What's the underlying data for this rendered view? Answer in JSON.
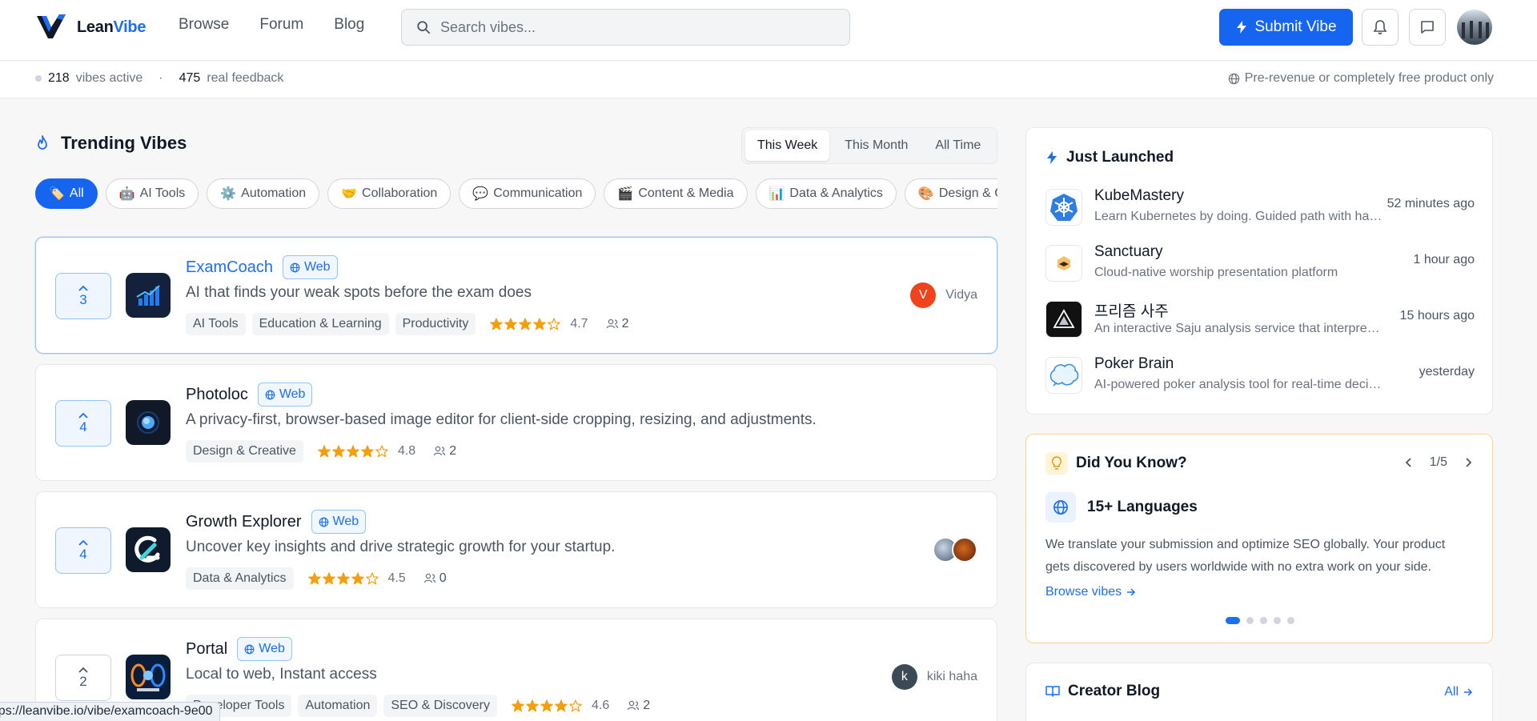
{
  "header": {
    "logo_text_a": "Lean",
    "logo_text_b": "Vibe",
    "nav": [
      "Browse",
      "Forum",
      "Blog"
    ],
    "search_placeholder": "Search vibes...",
    "submit_label": "Submit Vibe",
    "accent": "#1565f0"
  },
  "subbar": {
    "active_count": "218",
    "active_label": "vibes active",
    "separator": "·",
    "feedback_count": "475",
    "feedback_label": "real feedback",
    "notice": "Pre-revenue or completely free product only"
  },
  "trending": {
    "title": "Trending Vibes",
    "periods": [
      "This Week",
      "This Month",
      "All Time"
    ],
    "active_period": "This Week",
    "categories": [
      {
        "icon": "🏷️",
        "label": "All"
      },
      {
        "icon": "🤖",
        "label": "AI Tools"
      },
      {
        "icon": "⚙️",
        "label": "Automation"
      },
      {
        "icon": "🤝",
        "label": "Collaboration"
      },
      {
        "icon": "💬",
        "label": "Communication"
      },
      {
        "icon": "🎬",
        "label": "Content & Media"
      },
      {
        "icon": "📊",
        "label": "Data & Analytics"
      },
      {
        "icon": "🎨",
        "label": "Design & Creative"
      }
    ],
    "items": [
      {
        "votes": "3",
        "name": "ExamCoach",
        "platform": "Web",
        "desc": "AI that finds your weak spots before the exam does",
        "tags": [
          "AI Tools",
          "Education & Learning",
          "Productivity"
        ],
        "rating": "4.7",
        "stars": 4.7,
        "users": "2",
        "author": "Vidya",
        "author_initial": "V"
      },
      {
        "votes": "4",
        "name": "Photoloc",
        "platform": "Web",
        "desc": "A privacy-first, browser-based image editor for client-side cropping, resizing, and adjustments.",
        "tags": [
          "Design & Creative"
        ],
        "rating": "4.8",
        "stars": 4.8,
        "users": "2"
      },
      {
        "votes": "4",
        "name": "Growth Explorer",
        "platform": "Web",
        "desc": "Uncover key insights and drive strategic growth for your startup.",
        "tags": [
          "Data & Analytics"
        ],
        "rating": "4.5",
        "stars": 4.5,
        "users": "0"
      },
      {
        "votes": "2",
        "name": "Portal",
        "platform": "Web",
        "desc": "Local to web, Instant access",
        "tags": [
          "Developer Tools",
          "Automation",
          "SEO & Discovery"
        ],
        "rating": "4.6",
        "stars": 4.6,
        "users": "2",
        "author": "kiki haha",
        "author_initial": "k"
      }
    ]
  },
  "just_launched": {
    "title": "Just Launched",
    "items": [
      {
        "name": "KubeMastery",
        "desc": "Learn Kubernetes by doing. Guided path with hands-on labs",
        "time": "52 minutes ago"
      },
      {
        "name": "Sanctuary",
        "desc": "Cloud-native worship presentation platform",
        "time": "1 hour ago"
      },
      {
        "name": "프리즘 사주",
        "desc": "An interactive Saju analysis service that interprets your destiny",
        "time": "15 hours ago"
      },
      {
        "name": "Poker Brain",
        "desc": "AI-powered poker analysis tool for real-time decisions",
        "time": "yesterday"
      }
    ]
  },
  "did_you_know": {
    "title": "Did You Know?",
    "page": "1/5",
    "fact_title": "15+ Languages",
    "fact_body_1": "We translate your submission and optimize SEO globally. Your product",
    "fact_body_2": "gets discovered by users worldwide with no extra work on your side.",
    "link": "Browse vibes",
    "slides": 5,
    "active_slide": 1
  },
  "creator_blog": {
    "title": "Creator Blog",
    "link": "All"
  },
  "status_url": "https://leanvibe.io/vibe/examcoach-9e00"
}
